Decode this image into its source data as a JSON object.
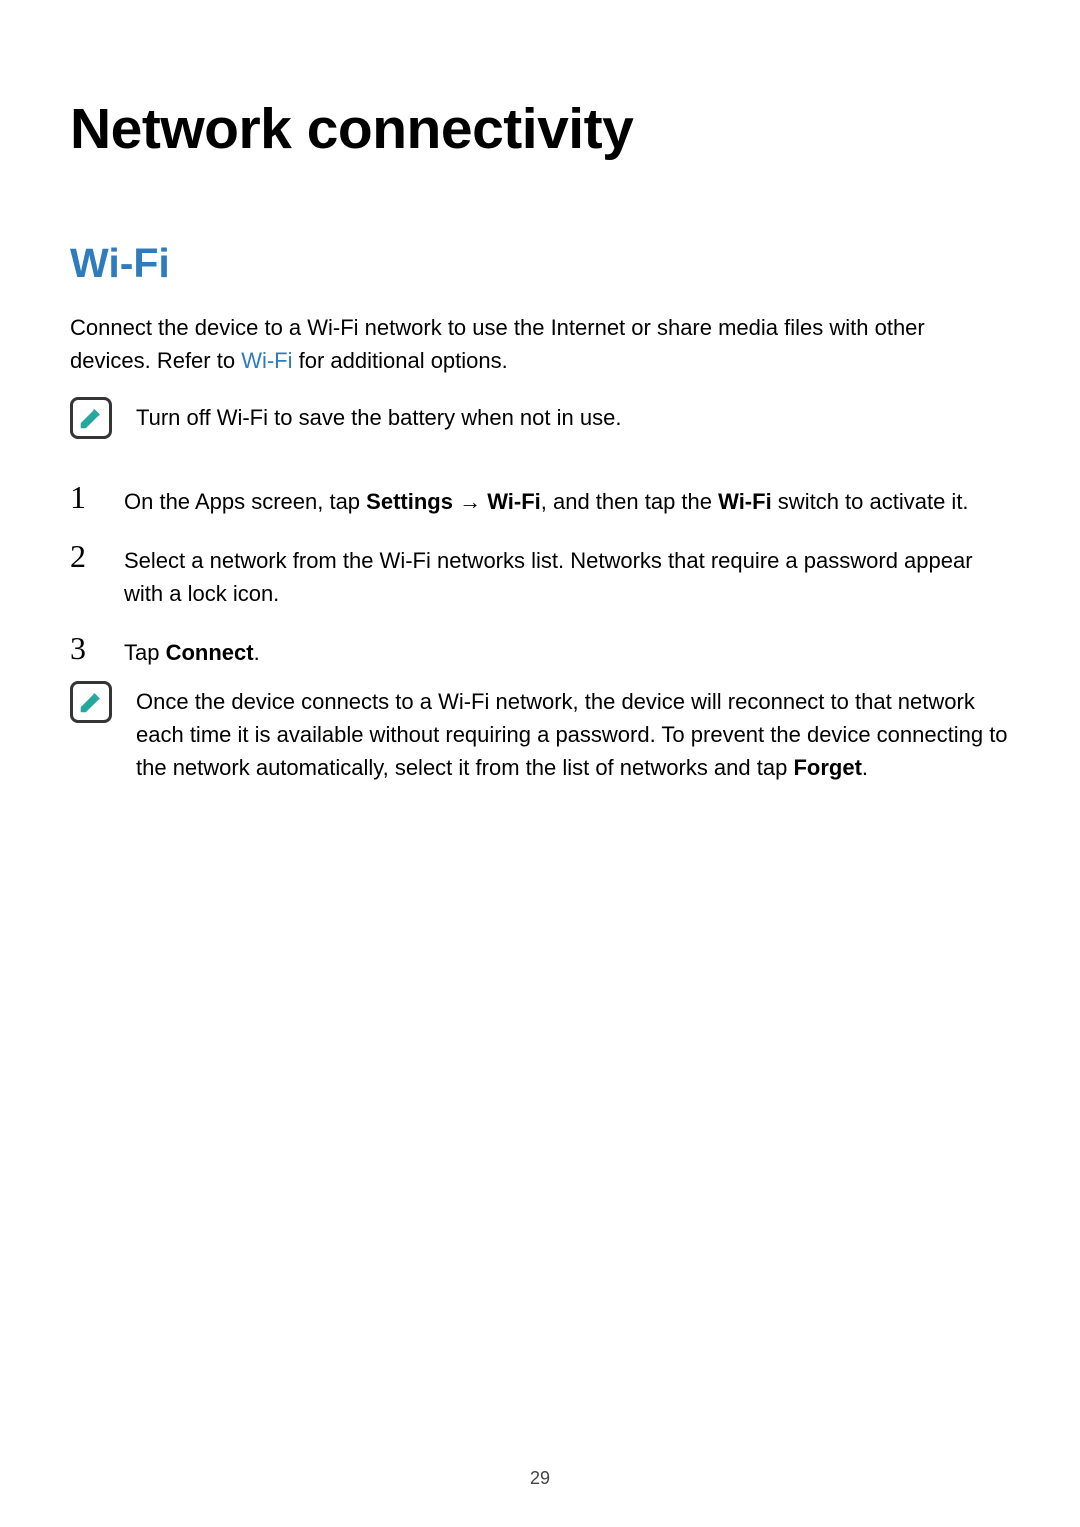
{
  "colors": {
    "accent": "#2f7cbd",
    "iconStroke": "#353535",
    "iconFill": "#24a89e"
  },
  "page": {
    "title": "Network connectivity",
    "section_heading": "Wi-Fi",
    "intro_pre": "Connect the device to a Wi-Fi network to use the Internet or share media files with other devices. Refer to ",
    "intro_link": "Wi-Fi",
    "intro_post": " for additional options.",
    "note1": "Turn off Wi-Fi to save the battery when not in use.",
    "steps": {
      "n1": "1",
      "s1_a": "On the Apps screen, tap ",
      "s1_bold1": "Settings",
      "s1_arrow": " → ",
      "s1_bold2": "Wi-Fi",
      "s1_b": ", and then tap the ",
      "s1_bold3": "Wi-Fi",
      "s1_c": " switch to activate it.",
      "n2": "2",
      "s2": "Select a network from the Wi-Fi networks list. Networks that require a password appear with a lock icon.",
      "n3": "3",
      "s3_a": "Tap ",
      "s3_bold": "Connect",
      "s3_b": "."
    },
    "note2_a": "Once the device connects to a Wi-Fi network, the device will reconnect to that network each time it is available without requiring a password. To prevent the device connecting to the network automatically, select it from the list of networks and tap ",
    "note2_bold": "Forget",
    "note2_b": ".",
    "page_number": "29"
  }
}
